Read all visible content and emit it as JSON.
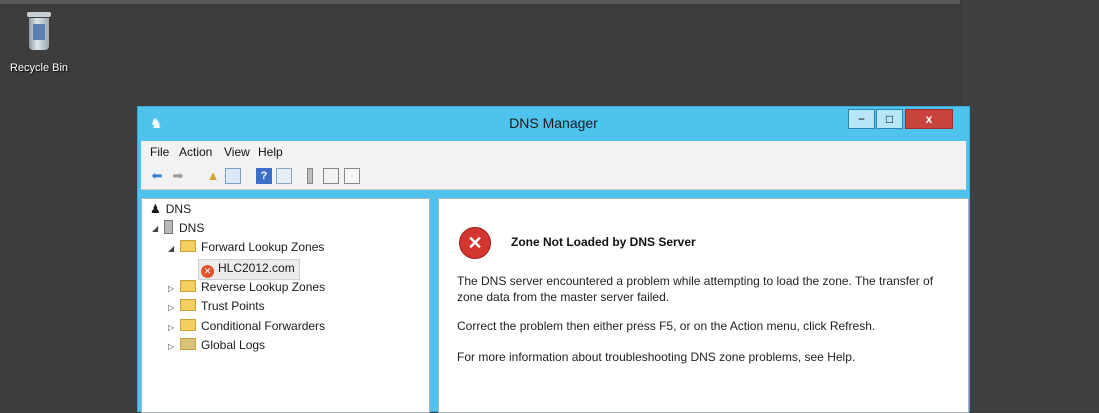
{
  "desktop": {
    "recycle_bin_label": "Recycle Bin"
  },
  "window": {
    "title": "DNS Manager",
    "minimize": "−",
    "maximize": "□",
    "close": "x"
  },
  "menu": [
    "File",
    "Action",
    "View",
    "Help"
  ],
  "toolbar": {
    "icons": [
      "back-arrow-icon",
      "forward-arrow-icon",
      "up-folder-icon",
      "show-tree-icon",
      "help-icon",
      "properties-icon",
      "server-icon",
      "list-icon",
      "export-icon"
    ]
  },
  "tree": {
    "root": "DNS",
    "server": "DNS",
    "forward": "Forward Lookup Zones",
    "zone": "HLC2012.com",
    "reverse": "Reverse Lookup Zones",
    "trust": "Trust Points",
    "conditional": "Conditional Forwarders",
    "global": "Global Logs"
  },
  "main": {
    "heading": "Zone Not Loaded by DNS Server",
    "paragraph1": "The DNS server encountered a problem while attempting to load the zone. The transfer of zone data from the master server failed.",
    "paragraph2": "Correct the problem then either press F5, or on the Action menu, click Refresh.",
    "paragraph3": "For more information about troubleshooting DNS zone problems, see Help."
  },
  "colors": {
    "titlebar": "#4fc3ee",
    "close_button": "#c7433b",
    "desktop": "#3d3d3d",
    "error": "#d3362f"
  }
}
